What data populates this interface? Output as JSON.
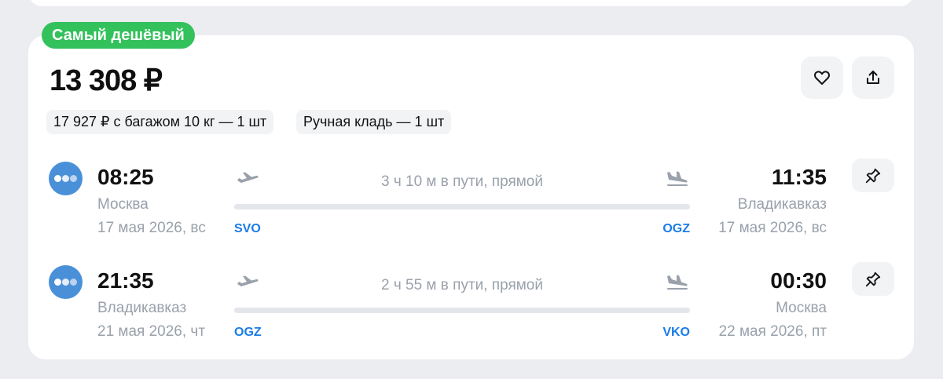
{
  "badge": "Самый дешёвый",
  "price": "13 308 ₽",
  "chips": [
    "17 927 ₽ с багажом 10 кг — 1 шт",
    "Ручная кладь — 1 шт"
  ],
  "segments": [
    {
      "dep_time": "08:25",
      "dep_city": "Москва",
      "dep_date": "17 мая 2026, вс",
      "dep_iata": "SVO",
      "duration": "3 ч 10 м в пути, прямой",
      "arr_time": "11:35",
      "arr_city": "Владикавказ",
      "arr_date": "17 мая 2026, вс",
      "arr_iata": "OGZ"
    },
    {
      "dep_time": "21:35",
      "dep_city": "Владикавказ",
      "dep_date": "21 мая 2026, чт",
      "dep_iata": "OGZ",
      "duration": "2 ч 55 м в пути, прямой",
      "arr_time": "00:30",
      "arr_city": "Москва",
      "arr_date": "22 мая 2026, пт",
      "arr_iata": "VKO"
    }
  ],
  "icons": {
    "favorite": "heart-icon",
    "share": "share-icon",
    "pin": "pin-icon",
    "takeoff": "takeoff-plane-icon",
    "landing": "landing-plane-icon",
    "airline": "airline-logo-icon"
  },
  "colors": {
    "badge": "#33c15c",
    "iata": "#1a7ce6",
    "airline_logo": "#4a90d9",
    "muted_text": "#9aa1ab",
    "background": "#ebedf0"
  }
}
